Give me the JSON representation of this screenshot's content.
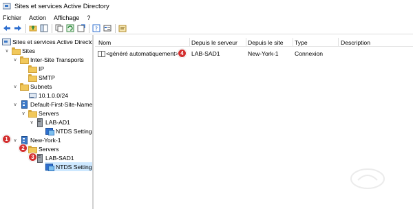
{
  "window": {
    "title": "Sites et services Active Directory"
  },
  "menu": {
    "items": [
      "Fichier",
      "Action",
      "Affichage",
      "?"
    ]
  },
  "toolbar": {
    "buttons": [
      "back-icon",
      "forward-icon",
      "up-folder-icon",
      "show-tree-icon",
      "copy-icon",
      "refresh-icon",
      "export-icon",
      "help-icon",
      "properties-icon",
      "new-connection-icon"
    ]
  },
  "tree": {
    "root": "Sites et services Active Directory",
    "sites": "Sites",
    "inter_site_transports": "Inter-Site Transports",
    "ip": "IP",
    "smtp": "SMTP",
    "subnets": "Subnets",
    "subnet_1": "10.1.0.0/24",
    "default_site": "Default-First-Site-Name",
    "servers_1": "Servers",
    "lab_ad1": "LAB-AD1",
    "ntds_1": "NTDS Settings",
    "new_york": "New-York-1",
    "servers_2": "Servers",
    "lab_sad1": "LAB-SAD1",
    "ntds_2": "NTDS Settings"
  },
  "badges": {
    "b1": "1",
    "b2": "2",
    "b3": "3",
    "b4": "4"
  },
  "list": {
    "columns": [
      "Nom",
      "Depuis le serveur",
      "Depuis le site",
      "Type",
      "Description"
    ],
    "rows": [
      {
        "nom": "<généré automatiquement>",
        "from_server": "LAB-SAD1",
        "from_site": "New-York-1",
        "type": "Connexion",
        "description": ""
      }
    ]
  },
  "colors": {
    "selection": "#cde8ff",
    "badge": "#d32f2f",
    "folder": "#f1c85b"
  }
}
